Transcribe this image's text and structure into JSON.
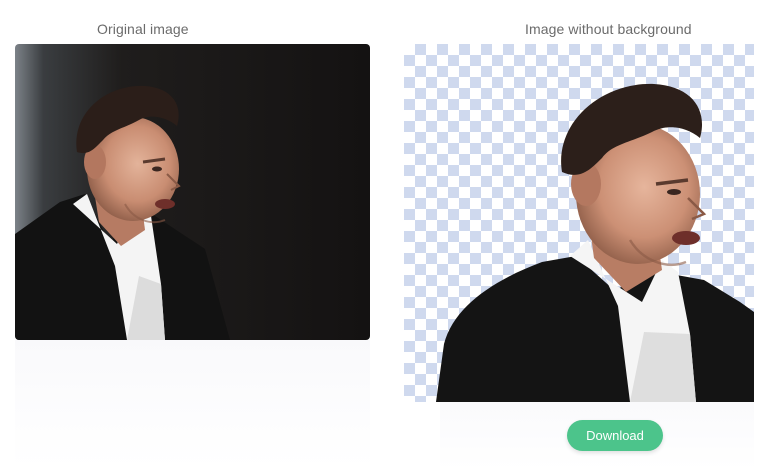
{
  "captions": {
    "original": "Original image",
    "result": "Image without background"
  },
  "actions": {
    "download_label": "Download"
  },
  "colors": {
    "button_bg": "#4cc48b",
    "caption_text": "#6b6b6b",
    "checker": "#cfd9ee"
  }
}
